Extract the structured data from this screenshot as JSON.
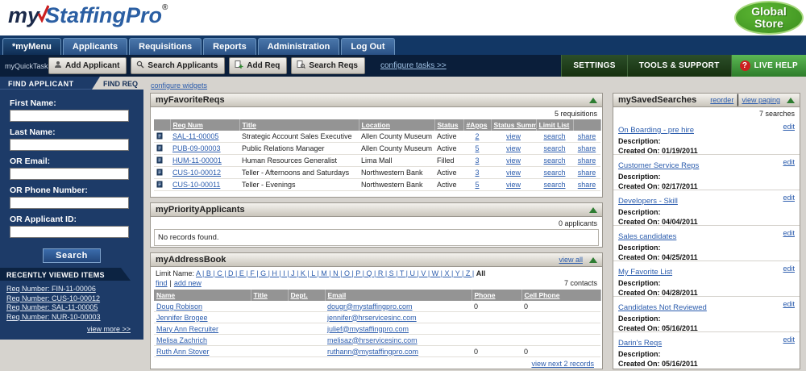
{
  "ui": {
    "sep": "|"
  },
  "header": {
    "logo_my": "my",
    "logo_staffing": "StaffingPro",
    "logo_reg": "®",
    "global_store_line1": "Global",
    "global_store_line2": "Store"
  },
  "nav": {
    "tabs": [
      "*myMenu",
      "Applicants",
      "Requisitions",
      "Reports",
      "Administration",
      "Log Out"
    ]
  },
  "quicktasks": {
    "label": "myQuickTasks:",
    "btn_add_applicant": "Add Applicant",
    "btn_search_applicants": "Search Applicants",
    "btn_add_req": "Add Req",
    "btn_search_reqs": "Search Reqs",
    "configure_link": "configure tasks >>",
    "settings": "SETTINGS",
    "tools": "TOOLS & SUPPORT",
    "live_help": "LIVE HELP",
    "help_qmark": "?"
  },
  "sidebar": {
    "tab_find_applicant": "FIND APPLICANT",
    "tab_find_req": "FIND REQ",
    "fields": {
      "first_name": "First Name:",
      "last_name": "Last Name:",
      "email": "OR Email:",
      "phone": "OR Phone Number:",
      "applicant_id": "OR Applicant ID:"
    },
    "search_button": "Search",
    "recent_title": "RECENTLY VIEWED ITEMS",
    "recent_items": [
      "Req Number: FIN-11-00006",
      "Req Number: CUS-10-00012",
      "Req Number: SAL-11-00005",
      "Req Number: NUR-10-00003"
    ],
    "view_more": "view more >>"
  },
  "main": {
    "configure_widgets": "configure widgets"
  },
  "favreqs": {
    "title": "myFavoriteReqs",
    "count": "5 requisitions",
    "headers": [
      "Req Num",
      "Title",
      "Location",
      "Status",
      "#Apps",
      "Status Summary",
      "Limit List"
    ],
    "link_view": "view",
    "link_search": "search",
    "link_share": "share",
    "rows": [
      {
        "req": "SAL-11-00005",
        "title": "Strategic Account Sales Executive",
        "loc": "Allen County Museum",
        "status": "Active",
        "apps": "2"
      },
      {
        "req": "PUB-09-00003",
        "title": "Public Relations Manager",
        "loc": "Allen County Museum",
        "status": "Active",
        "apps": "5"
      },
      {
        "req": "HUM-11-00001",
        "title": "Human Resources Generalist",
        "loc": "Lima Mall",
        "status": "Filled",
        "apps": "3"
      },
      {
        "req": "CUS-10-00012",
        "title": "Teller - Afternoons and Saturdays",
        "loc": "Northwestern Bank",
        "status": "Active",
        "apps": "3"
      },
      {
        "req": "CUS-10-00011",
        "title": "Teller - Evenings",
        "loc": "Northwestern Bank",
        "status": "Active",
        "apps": "5"
      }
    ]
  },
  "priority": {
    "title": "myPriorityApplicants",
    "count": "0 applicants",
    "empty": "No records found."
  },
  "addressbook": {
    "title": "myAddressBook",
    "view_all": "view all",
    "limit_label": "Limit Name:",
    "letters": "A | B | C | D | E | F | G | H | I | J | K | L | M | N | O | P | Q | R | S | T | U | V | W | X | Y | Z |",
    "letters_all": "All",
    "find": "find",
    "add_new": "add new",
    "count": "7 contacts",
    "headers": [
      "Name",
      "Title",
      "Dept.",
      "Email",
      "Phone",
      "Cell Phone"
    ],
    "rows": [
      {
        "name": "Doug Robison",
        "title": "",
        "dept": "",
        "email": "dougr@mystaffingpro.com",
        "phone": "0",
        "cell": "0"
      },
      {
        "name": "Jennifer Brogee",
        "title": "",
        "dept": "",
        "email": "jennifer@hrservicesinc.com",
        "phone": "",
        "cell": ""
      },
      {
        "name": "Mary Ann Recruiter",
        "title": "",
        "dept": "",
        "email": "julief@mystaffingpro.com",
        "phone": "",
        "cell": ""
      },
      {
        "name": "Melisa Zachrich",
        "title": "",
        "dept": "",
        "email": "melisaz@hrservicesinc.com",
        "phone": "",
        "cell": ""
      },
      {
        "name": "Ruth Ann Stover",
        "title": "",
        "dept": "",
        "email": "ruthann@mystaffingpro.com",
        "phone": "0",
        "cell": "0"
      }
    ],
    "view_next": "view next 2 records"
  },
  "savedsearches": {
    "title": "mySavedSearches",
    "reorder": "reorder",
    "view_paging": "view paging",
    "count": "7 searches",
    "desc_label": "Description:",
    "created_label": "Created On:",
    "edit": "edit",
    "items": [
      {
        "name": "On Boarding - pre hire",
        "created": "01/19/2011"
      },
      {
        "name": "Customer Service Reps",
        "created": "02/17/2011"
      },
      {
        "name": "Developers - Skill",
        "created": "04/04/2011"
      },
      {
        "name": "Sales candidates",
        "created": "04/25/2011"
      },
      {
        "name": "My Favorite List",
        "created": "04/28/2011"
      },
      {
        "name": "Candidates Not Reviewed",
        "created": "05/16/2011"
      },
      {
        "name": "Darin's Reqs",
        "created": "05/16/2011"
      }
    ]
  }
}
